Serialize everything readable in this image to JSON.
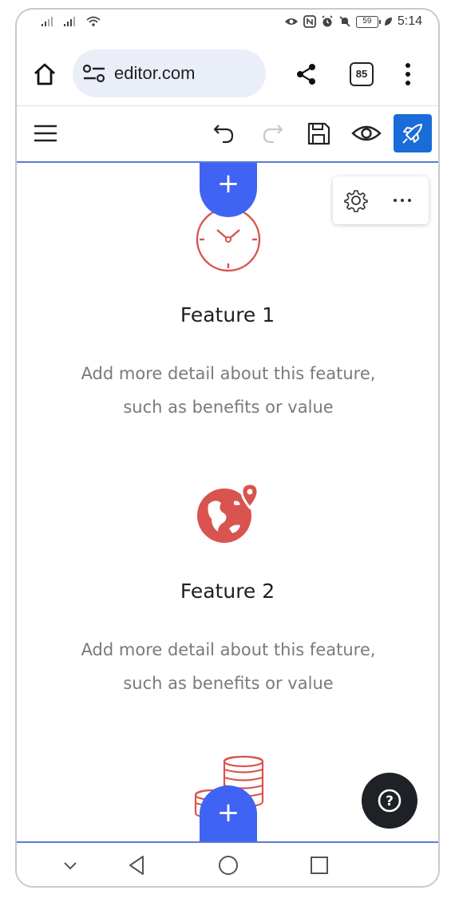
{
  "status_bar": {
    "time": "5:14",
    "battery": "59",
    "icons": [
      "signal-icon",
      "signal-icon",
      "wifi-icon",
      "eye-icon",
      "nfc-icon",
      "alarm-icon",
      "mute-icon",
      "battery-icon",
      "leaf-icon"
    ]
  },
  "browser": {
    "url": "editor.com",
    "tab_count": "85",
    "icons": [
      "home-icon",
      "site-settings-icon",
      "share-icon",
      "tabs-icon",
      "overflow-menu-icon"
    ]
  },
  "toolbar": {
    "icons": [
      "hamburger-menu-icon",
      "undo-icon",
      "redo-icon",
      "save-icon",
      "preview-icon",
      "rocket-icon"
    ],
    "accent": "#1a6cd8"
  },
  "block_toolbar": {
    "icons": [
      "gear-icon",
      "more-icon"
    ]
  },
  "add_block": {
    "symbol": "+",
    "color": "#3f63f3"
  },
  "features": [
    {
      "icon": "clock-icon",
      "title": "Feature 1",
      "description_line1": "Add more detail about this feature,",
      "description_line2": "such as benefits or value"
    },
    {
      "icon": "globe-pin-icon",
      "title": "Feature 2",
      "description_line1": "Add more detail about this feature,",
      "description_line2": "such as benefits or value"
    },
    {
      "icon": "coins-icon"
    }
  ],
  "icon_color": "#d9534f",
  "help": {
    "symbol": "?",
    "color": "#1e2126"
  },
  "nav_bar": {
    "icons": [
      "chevron-down-icon",
      "back-icon",
      "home-circle-icon",
      "recents-icon"
    ]
  }
}
